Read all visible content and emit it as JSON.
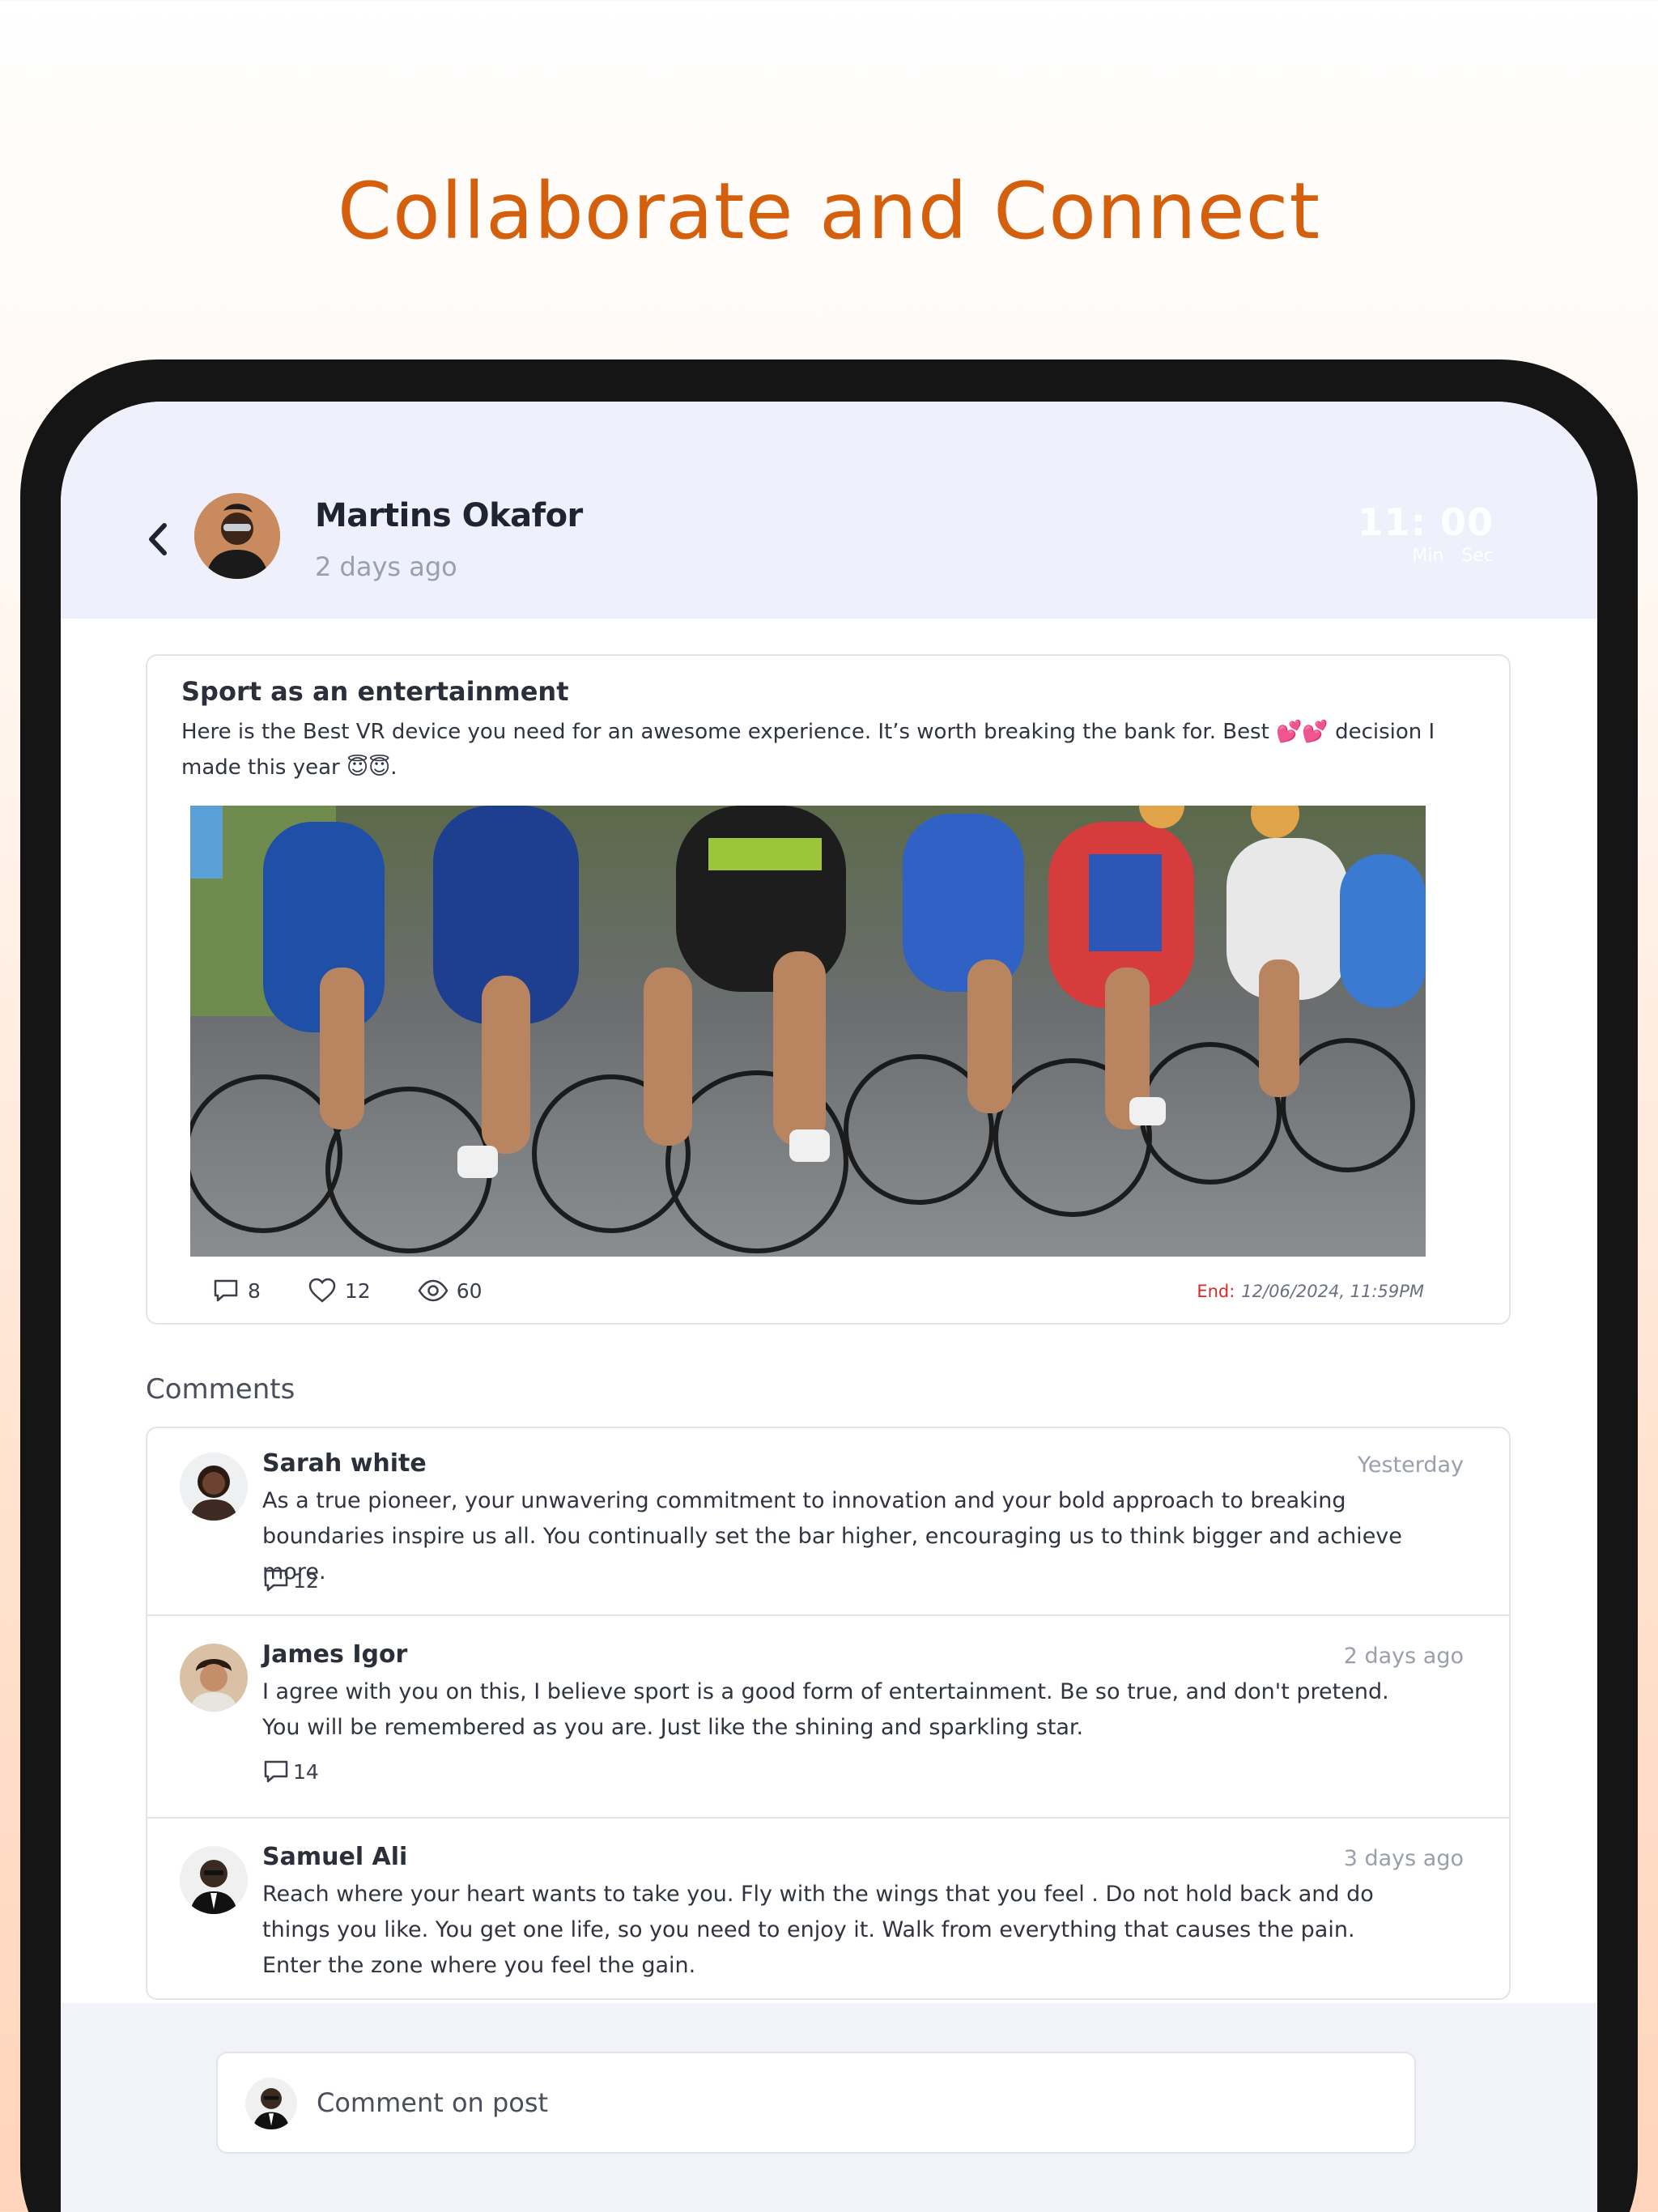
{
  "headline": "Collaborate and Connect",
  "header": {
    "author_name": "Martins Okafor",
    "posted_time": "2 days ago",
    "timer_value": "11: 00",
    "timer_min_label": "Min",
    "timer_sec_label": "Sec"
  },
  "post": {
    "title": "Sport as an entertainment",
    "body": "Here is the Best VR device you need for an awesome experience. It’s worth breaking the bank for. Best 💕💕 decision I made this year 😇😇.",
    "comments_count": "8",
    "likes_count": "12",
    "views_count": "60",
    "end_label": "End:",
    "end_value": "12/06/2024, 11:59PM"
  },
  "comments_title": "Comments",
  "comments": [
    {
      "name": "Sarah white",
      "time": "Yesterday",
      "text": "As a true pioneer, your unwavering commitment to innovation and your bold approach to breaking boundaries inspire us all. You continually set the bar higher, encouraging us to think bigger and achieve more.",
      "replies": "12"
    },
    {
      "name": "James Igor",
      "time": "2 days ago",
      "text": "I agree with you on this, I believe sport is a good form of entertainment. Be so true, and don't pretend. You will be remembered as you are. Just like the shining and sparkling star.",
      "replies": "14"
    },
    {
      "name": "Samuel Ali",
      "time": "3 days ago",
      "text": "Reach where your heart wants to take you. Fly with the wings that you feel . Do not hold back and do things you like. You get one life, so you need to enjoy it. Walk from everything that causes the pain. Enter the zone where you feel the gain."
    }
  ],
  "comment_input": {
    "placeholder": "Comment on post"
  },
  "colors": {
    "accent": "#d4600e",
    "header_bg": "#eef1fb",
    "end_label": "#d42a2a"
  }
}
